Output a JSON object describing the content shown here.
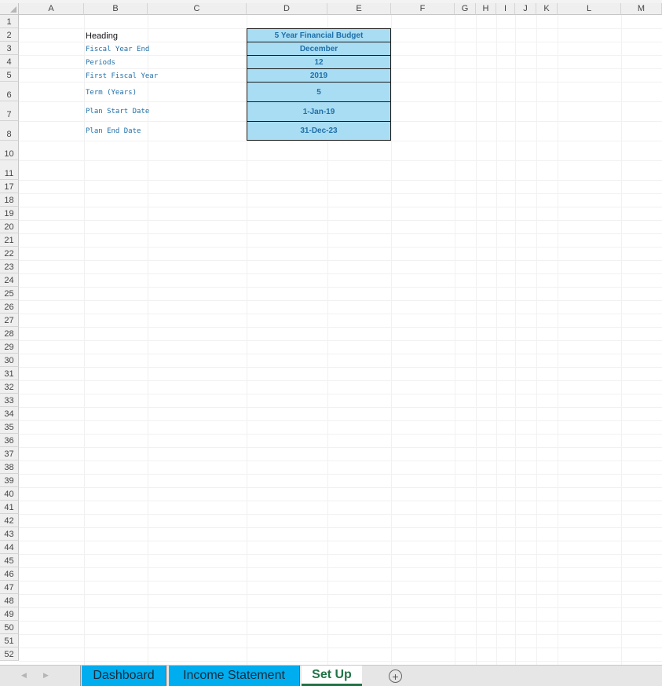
{
  "columns": [
    "A",
    "B",
    "C",
    "D",
    "E",
    "F",
    "G",
    "H",
    "I",
    "J",
    "K",
    "L",
    "M"
  ],
  "rows": [
    "1",
    "2",
    "3",
    "4",
    "5",
    "6",
    "7",
    "8",
    "10",
    "11",
    "17",
    "18",
    "19",
    "20",
    "21",
    "22",
    "23",
    "24",
    "25",
    "26",
    "27",
    "28",
    "29",
    "30",
    "31",
    "32",
    "33",
    "34",
    "35",
    "36",
    "37",
    "38",
    "39",
    "40",
    "41",
    "42",
    "43",
    "44",
    "45",
    "46",
    "47",
    "48",
    "49",
    "50",
    "51",
    "52"
  ],
  "setup": {
    "labels": {
      "heading": "Heading",
      "fiscal_year_end": "Fiscal Year End",
      "periods": "Periods",
      "first_fiscal_year": "First Fiscal Year",
      "term_years": "Term (Years)",
      "plan_start_date": "Plan Start Date",
      "plan_end_date": "Plan End Date"
    },
    "values": {
      "heading": "5 Year Financial Budget",
      "fiscal_year_end": "December",
      "periods": "12",
      "first_fiscal_year": "2019",
      "term_years": "5",
      "plan_start_date": "1-Jan-19",
      "plan_end_date": "31-Dec-23"
    }
  },
  "tabs": {
    "dashboard": "Dashboard",
    "income_statement": "Income Statement",
    "set_up": "Set Up",
    "add_symbol": "+"
  },
  "colors": {
    "value_fill": "#a9ddf3",
    "value_text": "#1f6fa8",
    "inactive_tab": "#00adef",
    "active_tab_text": "#217346"
  },
  "icons": [
    "scroll-left-icon",
    "scroll-right-icon",
    "add-sheet-icon"
  ]
}
